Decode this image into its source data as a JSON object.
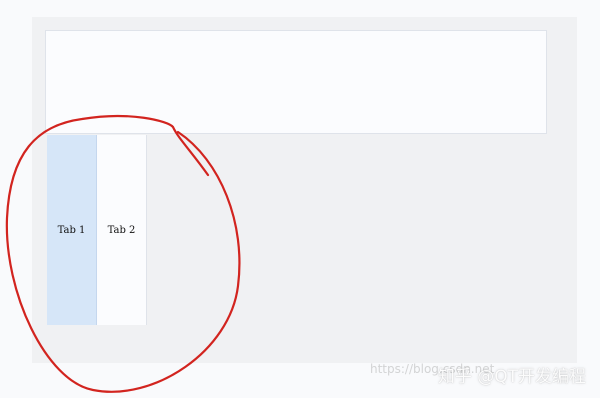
{
  "tabs": [
    {
      "label": "Tab 1",
      "selected": true
    },
    {
      "label": "Tab 2",
      "selected": false
    }
  ],
  "watermark": "https://blog.csdn.net",
  "brand": "知乎 @QT开发编程",
  "colors": {
    "window_bg": "#f0f1f3",
    "panel_bg": "#fbfcfe",
    "tab_selected_bg": "#d6e6f8",
    "annotation_red": "#d2241f"
  }
}
